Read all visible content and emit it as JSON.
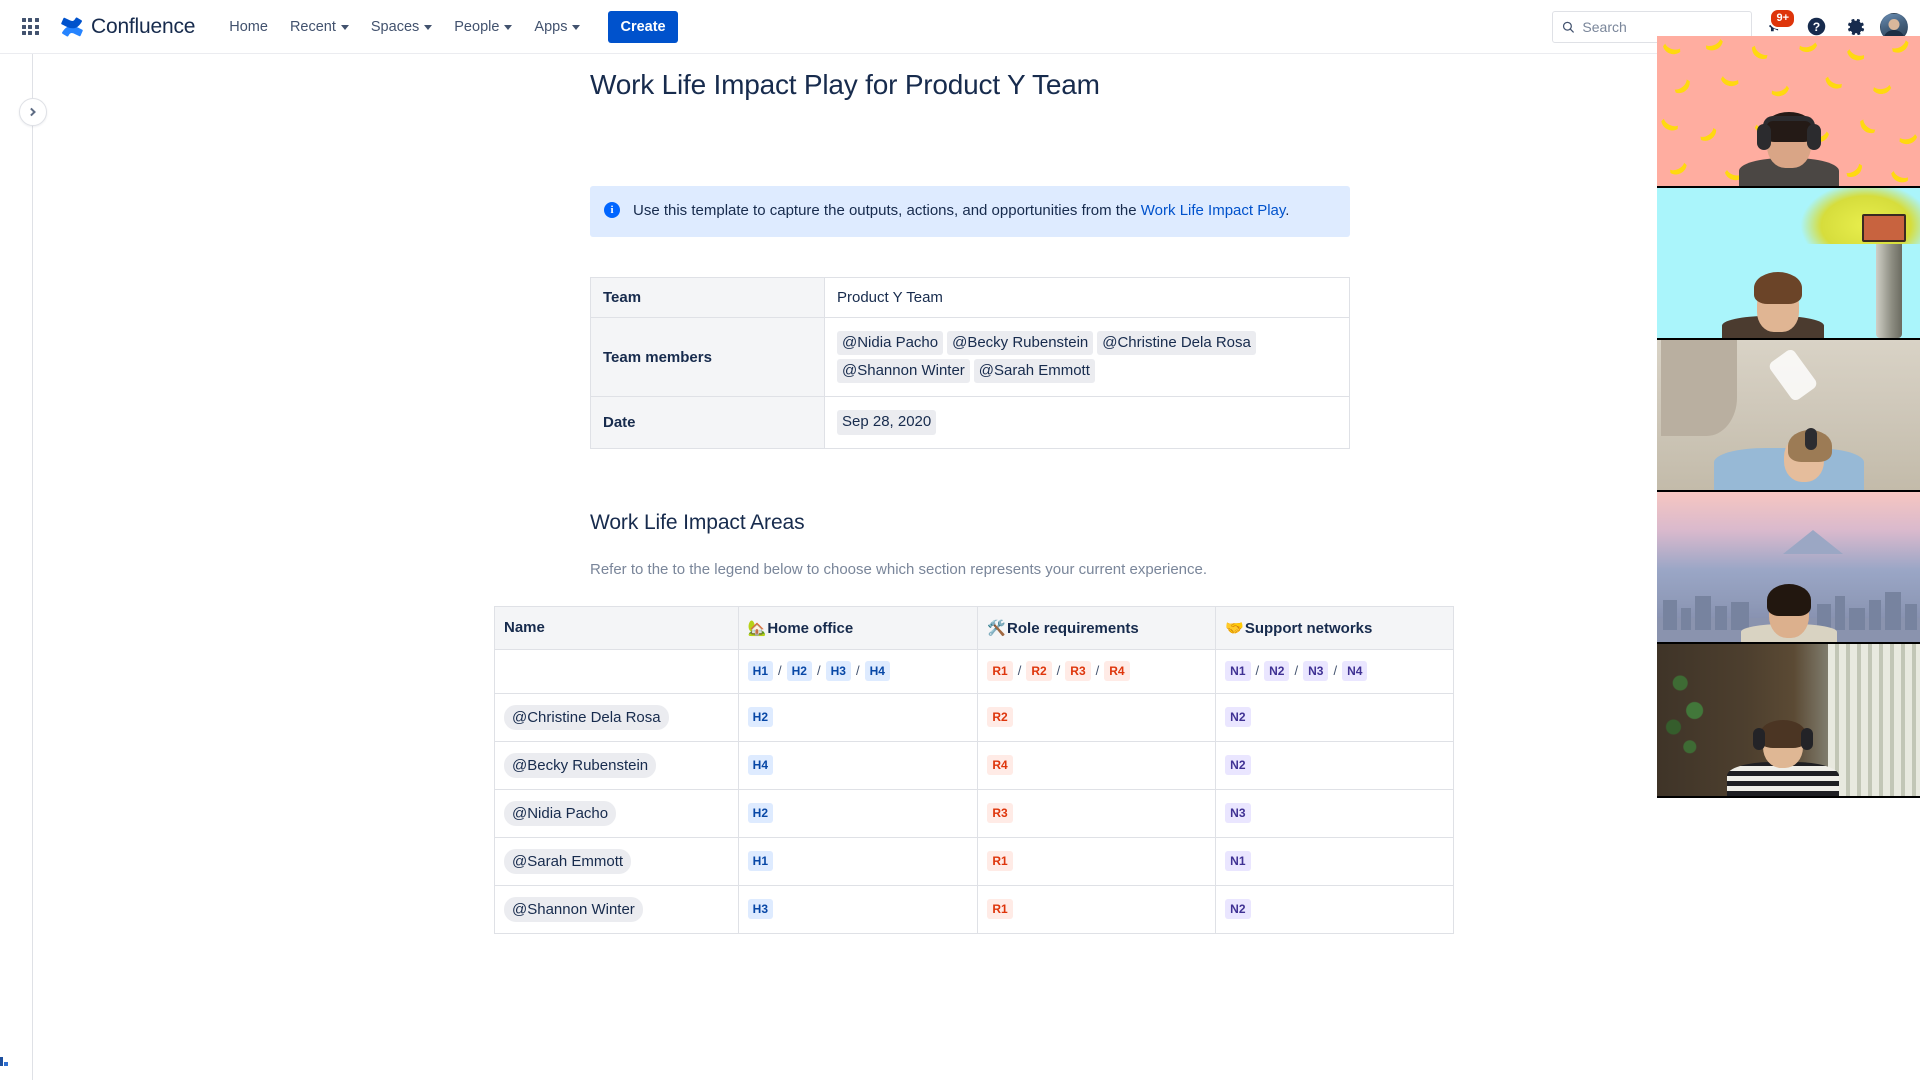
{
  "topnav": {
    "app_switcher_icon": "grid-apps-icon",
    "brand": "Confluence",
    "items": [
      {
        "label": "Home",
        "has_caret": false
      },
      {
        "label": "Recent",
        "has_caret": true
      },
      {
        "label": "Spaces",
        "has_caret": true
      },
      {
        "label": "People",
        "has_caret": true
      },
      {
        "label": "Apps",
        "has_caret": true
      }
    ],
    "create_label": "Create",
    "search": {
      "value": "",
      "placeholder": "Search",
      "icon": "search-icon"
    },
    "notifications": {
      "icon": "megaphone-icon",
      "badge": "9+"
    },
    "help": {
      "icon": "help-icon"
    },
    "settings": {
      "icon": "gear-icon"
    },
    "profile": {
      "icon": "avatar"
    }
  },
  "leftrail": {
    "expand_icon": "chevron-right-icon",
    "corner_icon": "app-glyph-icon"
  },
  "document": {
    "title": "Work Life Impact Play for Product Y Team",
    "info_panel": {
      "icon": "info-icon",
      "text_before": "Use this template to capture the outputs, actions, and opportunities from the ",
      "link_text": "Work Life Impact Play",
      "text_after": "."
    },
    "meta_table": {
      "rows": [
        {
          "key": "Team",
          "value_type": "plain",
          "values": [
            "Product Y Team"
          ]
        },
        {
          "key": "Team members",
          "value_type": "chips",
          "values": [
            "@Nidia Pacho",
            "@Becky Rubenstein",
            "@Christine Dela Rosa",
            "@Shannon Winter",
            "@Sarah Emmott"
          ]
        },
        {
          "key": "Date",
          "value_type": "chips",
          "values": [
            "Sep 28, 2020"
          ]
        }
      ]
    },
    "section": {
      "heading": "Work Life Impact Areas",
      "subtitle": "Refer to the to the legend below to choose which section represents your current experience."
    },
    "impact_table": {
      "headers": [
        {
          "emoji": "",
          "label": "Name",
          "icon": "none"
        },
        {
          "emoji": "🏡",
          "label": "Home office",
          "icon": "house-with-garden-icon"
        },
        {
          "emoji": "🛠️",
          "label": "Role requirements",
          "icon": "hammer-and-wrench-icon"
        },
        {
          "emoji": "🤝",
          "label": "Support networks",
          "icon": "handshake-icon"
        }
      ],
      "legend_row": {
        "name": "",
        "home": [
          "H1",
          "H2",
          "H3",
          "H4"
        ],
        "role": [
          "R1",
          "R2",
          "R3",
          "R4"
        ],
        "support": [
          "N1",
          "N2",
          "N3",
          "N4"
        ],
        "separator": "/"
      },
      "rows": [
        {
          "name": "@Christine Dela Rosa",
          "home": "H2",
          "role": "R2",
          "support": "N2"
        },
        {
          "name": "@Becky Rubenstein",
          "home": "H4",
          "role": "R4",
          "support": "N2"
        },
        {
          "name": "@Nidia Pacho",
          "home": "H2",
          "role": "R3",
          "support": "N3"
        },
        {
          "name": "@Sarah Emmott",
          "home": "H1",
          "role": "R1",
          "support": "N1"
        },
        {
          "name": "@Shannon Winter",
          "home": "H3",
          "role": "R1",
          "support": "N2"
        }
      ]
    }
  },
  "video_panel": {
    "tiles": [
      {
        "name": "participant-tile-1",
        "background": "banana-pattern-virtual-background"
      },
      {
        "name": "participant-tile-2",
        "background": "cyan-treehouse-virtual-background"
      },
      {
        "name": "participant-tile-3",
        "background": "home-interior"
      },
      {
        "name": "participant-tile-4",
        "background": "city-skyline-virtual-background"
      },
      {
        "name": "participant-tile-5",
        "background": "home-office-with-blinds"
      }
    ]
  },
  "colors": {
    "brand_blue": "#0052cc",
    "link_blue": "#0052cc",
    "info_bg": "#deebff",
    "text_dark": "#172b4d",
    "text_subtle": "#7a869a",
    "border": "#dfe1e6",
    "header_bg": "#f4f5f7",
    "tag_home_bg": "#deebff",
    "tag_home_fg": "#0747a6",
    "tag_role_bg": "#ffebe6",
    "tag_role_fg": "#de350b",
    "tag_support_bg": "#eae6ff",
    "tag_support_fg": "#403294",
    "badge_red": "#de350b"
  }
}
